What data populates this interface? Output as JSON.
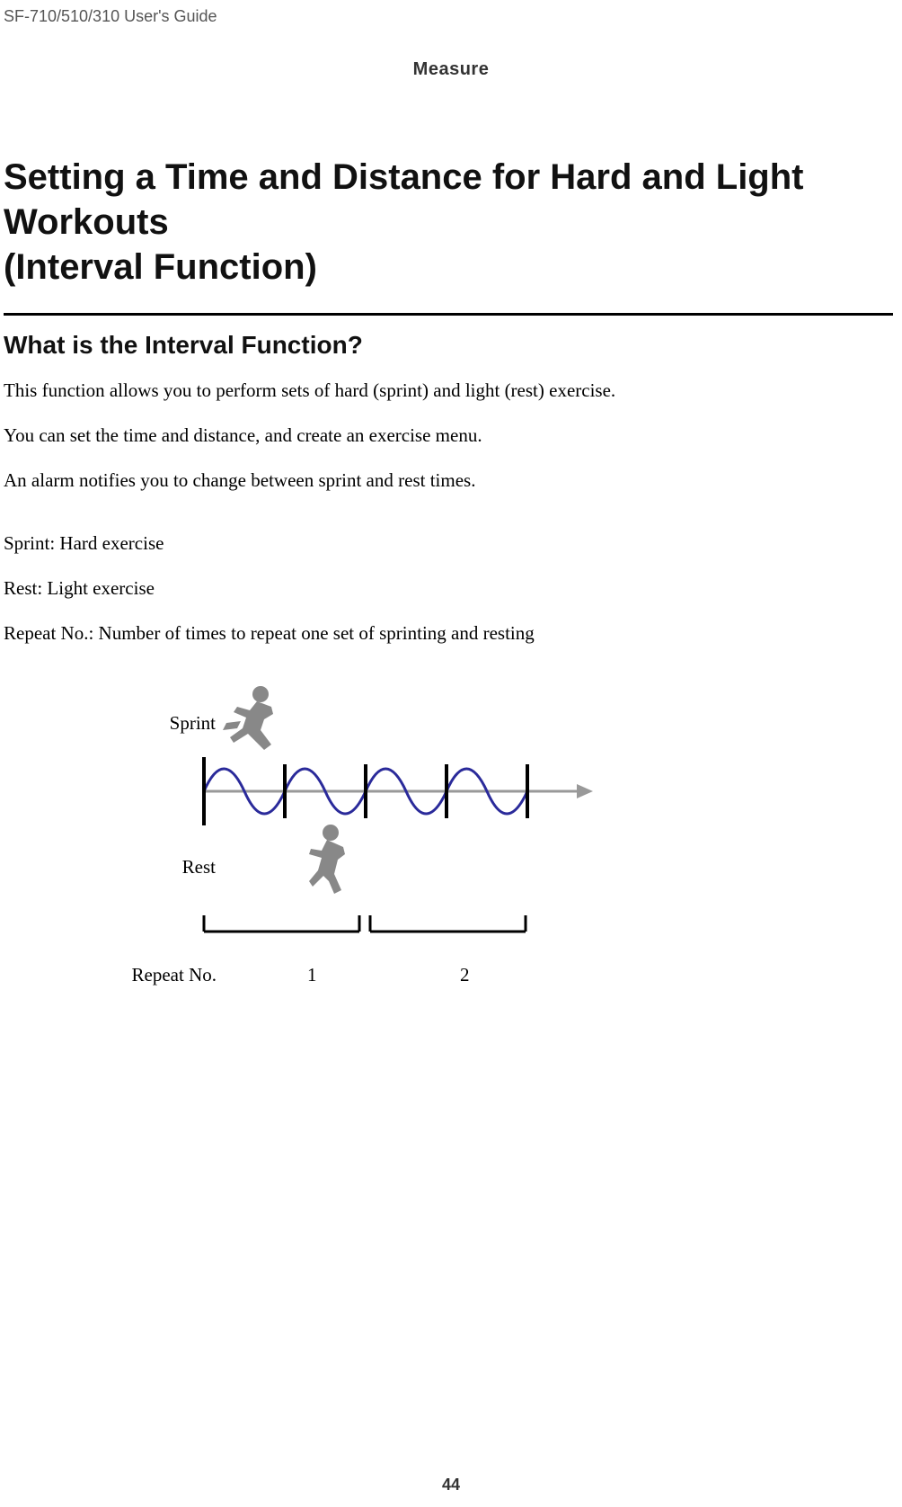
{
  "header_label": "SF-710/510/310     User's Guide",
  "section_label": "Measure",
  "main_title_line1": "Setting a Time and Distance for Hard and Light Workouts",
  "main_title_line2": "(Interval Function)",
  "sub_title": "What is the Interval Function?",
  "para1": "This function allows you to perform sets of hard (sprint) and light (rest) exercise.",
  "para2": "You can set the time and distance, and create an exercise menu.",
  "para3": "An alarm notifies you to change between sprint and rest times.",
  "para4": "Sprint: Hard exercise",
  "para5": "Rest: Light exercise",
  "para6": "Repeat No.: Number of times to repeat one set of sprinting and resting",
  "diagram": {
    "sprint_label": "Sprint",
    "rest_label": "Rest",
    "repeat_label": "Repeat No.",
    "repeat1": "1",
    "repeat2": "2"
  },
  "page_num": "44"
}
